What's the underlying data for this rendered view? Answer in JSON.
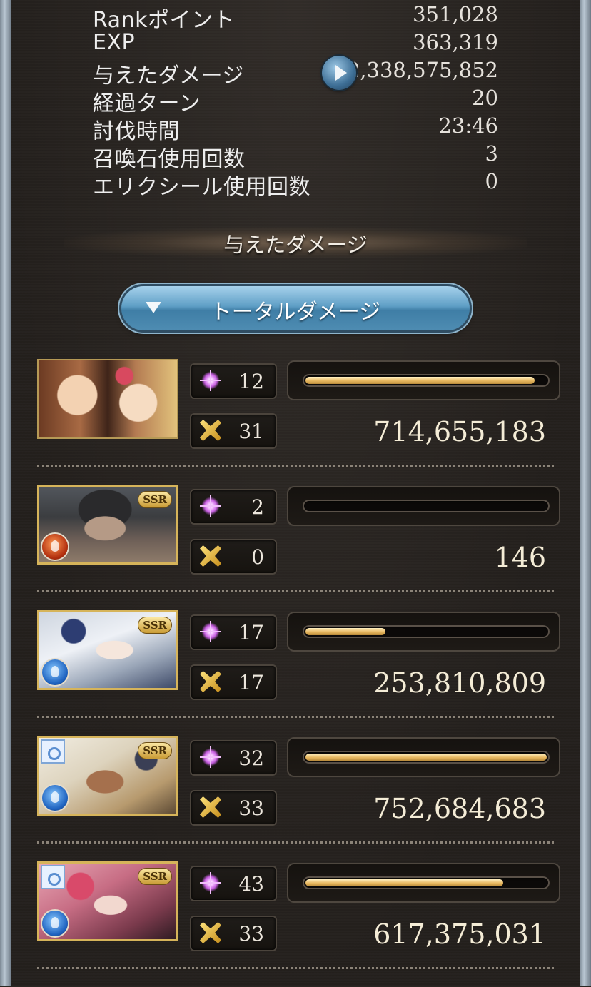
{
  "stats": [
    {
      "label": "Rankポイント",
      "value": "351,028"
    },
    {
      "label": "EXP",
      "value": "363,319"
    },
    {
      "label": "与えたダメージ",
      "value": "2,338,575,852"
    },
    {
      "label": "経過ターン",
      "value": "20"
    },
    {
      "label": "討伐時間",
      "value": "23:46"
    },
    {
      "label": "召喚石使用回数",
      "value": "3"
    },
    {
      "label": "エリクシール使用回数",
      "value": "0"
    }
  ],
  "section_title": "与えたダメージ",
  "dropdown_label": "トータルダメージ",
  "characters": [
    {
      "rarity": "",
      "element": "",
      "ring": false,
      "star_count": "12",
      "ca_count": "31",
      "damage": "714,655,183",
      "bar_fraction": 0.95
    },
    {
      "rarity": "SSR",
      "element": "fire",
      "ring": false,
      "star_count": "2",
      "ca_count": "0",
      "damage": "146",
      "bar_fraction": 0.0
    },
    {
      "rarity": "SSR",
      "element": "water",
      "ring": false,
      "star_count": "17",
      "ca_count": "17",
      "damage": "253,810,809",
      "bar_fraction": 0.33
    },
    {
      "rarity": "SSR",
      "element": "water",
      "ring": true,
      "star_count": "32",
      "ca_count": "33",
      "damage": "752,684,683",
      "bar_fraction": 1.0
    },
    {
      "rarity": "SSR",
      "element": "water",
      "ring": true,
      "star_count": "43",
      "ca_count": "33",
      "damage": "617,375,031",
      "bar_fraction": 0.82
    }
  ]
}
